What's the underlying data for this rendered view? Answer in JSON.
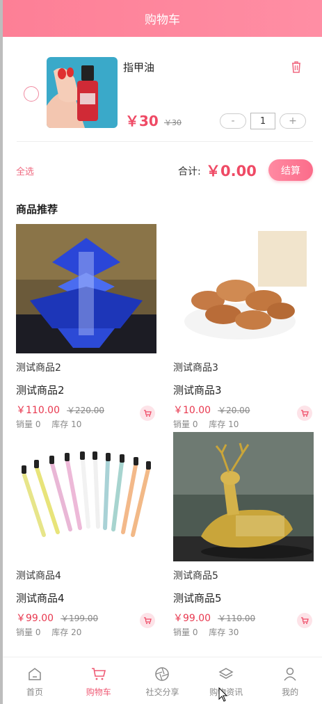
{
  "header": {
    "title": "购物车"
  },
  "cart": {
    "item": {
      "name": "指甲油",
      "price": "￥30",
      "old_price": "￥30",
      "quantity": "1",
      "minus": "-",
      "plus": "+"
    },
    "select_all": "全选",
    "total_label": "合计:",
    "total_value": "￥0.00",
    "checkout": "结算"
  },
  "recommend": {
    "title": "商品推荐",
    "products": [
      {
        "title": "测试商品2",
        "name": "测试商品2",
        "price": "￥110.00",
        "old_price": "￥220.00",
        "sales": "销量 0",
        "stock": "库存 10"
      },
      {
        "title": "测试商品3",
        "name": "测试商品3",
        "price": "￥10.00",
        "old_price": "￥20.00",
        "sales": "销量 0",
        "stock": "库存 10"
      },
      {
        "title": "测试商品4",
        "name": "测试商品4",
        "price": "￥99.00",
        "old_price": "￥199.00",
        "sales": "销量 0",
        "stock": "库存 20"
      },
      {
        "title": "测试商品5",
        "name": "测试商品5",
        "price": "￥99.00",
        "old_price": "￥110.00",
        "sales": "销量 0",
        "stock": "库存 30"
      }
    ]
  },
  "nav": {
    "items": [
      {
        "label": "首页",
        "icon": "home-icon"
      },
      {
        "label": "购物车",
        "icon": "cart-icon",
        "active": true
      },
      {
        "label": "社交分享",
        "icon": "aperture-icon"
      },
      {
        "label": "购物资讯",
        "icon": "layers-icon"
      },
      {
        "label": "我的",
        "icon": "user-icon"
      }
    ]
  },
  "colors": {
    "accent": "#fd7f96",
    "price": "#ef4a65"
  }
}
